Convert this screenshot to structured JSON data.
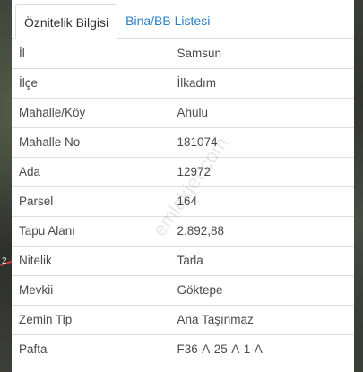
{
  "tabs": [
    {
      "label": "Öznitelik Bilgisi",
      "active": true
    },
    {
      "label": "Bina/BB Listesi",
      "active": false
    }
  ],
  "rows": [
    {
      "key": "İl",
      "value": "Samsun"
    },
    {
      "key": "İlçe",
      "value": "İlkadım"
    },
    {
      "key": "Mahalle/Köy",
      "value": "Ahulu"
    },
    {
      "key": "Mahalle No",
      "value": "181074"
    },
    {
      "key": "Ada",
      "value": "12972"
    },
    {
      "key": "Parsel",
      "value": "164"
    },
    {
      "key": "Tapu Alanı",
      "value": "2.892,88"
    },
    {
      "key": "Nitelik",
      "value": "Tarla"
    },
    {
      "key": "Mevkii",
      "value": "Göktepe"
    },
    {
      "key": "Zemin Tip",
      "value": "Ana Taşınmaz"
    },
    {
      "key": "Pafta",
      "value": "F36-A-25-A-1-A"
    }
  ],
  "watermark": "emlakjet.com",
  "map_marker": "2",
  "colors": {
    "tab_link": "#2a7fc9",
    "text": "#4a4a4a",
    "border": "#dddddd",
    "map_line": "#d23a3a"
  }
}
